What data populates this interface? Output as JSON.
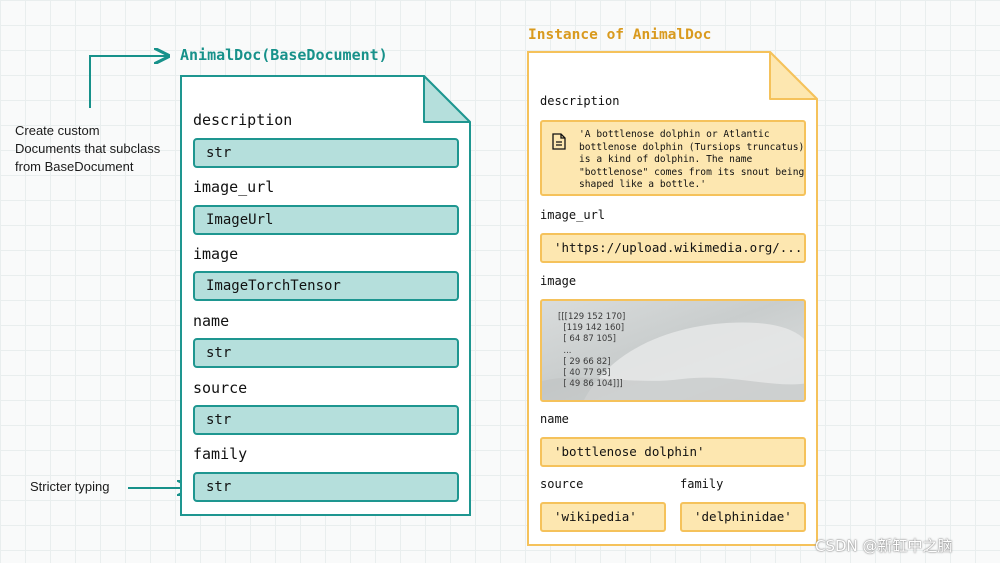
{
  "annotations": {
    "custom_documents": "Create custom\nDocuments that subclass\nfrom BaseDocument",
    "stricter_typing": "Stricter typing"
  },
  "schema_doc": {
    "title": "AnimalDoc(BaseDocument)",
    "fields": [
      {
        "label": "description",
        "type": "str"
      },
      {
        "label": "image_url",
        "type": "ImageUrl"
      },
      {
        "label": "image",
        "type": "ImageTorchTensor"
      },
      {
        "label": "name",
        "type": "str"
      },
      {
        "label": "source",
        "type": "str"
      },
      {
        "label": "family",
        "type": "str"
      }
    ]
  },
  "instance_doc": {
    "title": "Instance of AnimalDoc",
    "description_label": "description",
    "description_lines": [
      "'A bottlenose dolphin or Atlantic",
      "bottlenose dolphin (Tursiops truncatus)",
      "is a kind of dolphin. The name",
      "\"bottlenose\" comes from its snout being",
      "shaped like a bottle.'"
    ],
    "image_url_label": "image_url",
    "image_url_value": "'https://upload.wikimedia.org/...'",
    "image_label": "image",
    "tensor_lines": [
      "[[[129 152 170]",
      "  [119 142 160]",
      "  [ 64 87 105]",
      "  ...",
      "  [ 29 66 82]",
      "  [ 40 77 95]",
      "  [ 49 86 104]]]"
    ],
    "name_label": "name",
    "name_value": "'bottlenose dolphin'",
    "source_label": "source",
    "source_value": "'wikipedia'",
    "family_label": "family",
    "family_value": "'delphinidae'"
  },
  "icons": {
    "document": "document-icon"
  },
  "colors": {
    "schema_accent": "#17918a",
    "schema_fill": "#b5dfdc",
    "instance_accent": "#f5c25b",
    "instance_fill": "#fde7b0",
    "instance_title": "#d99a1e"
  },
  "watermark": "CSDN @新缸中之脑"
}
